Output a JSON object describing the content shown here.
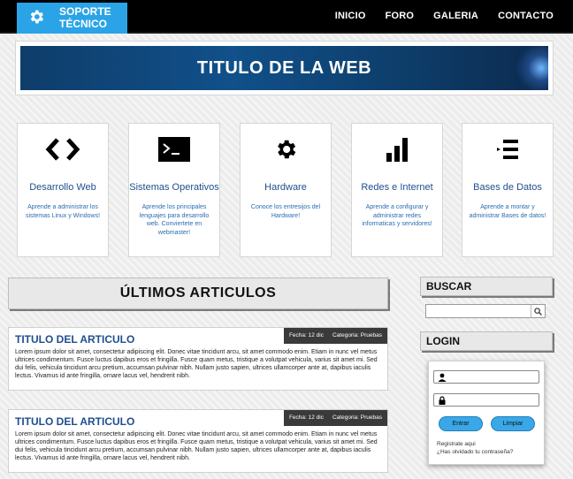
{
  "header": {
    "logo_text": "SOPORTE TÉCNICO",
    "nav": [
      "INICIO",
      "FORO",
      "GALERIA",
      "CONTACTO"
    ]
  },
  "banner": {
    "title": "TITULO DE LA WEB"
  },
  "cards": [
    {
      "icon": "code-icon",
      "title": "Desarrollo Web",
      "desc": "Aprende a administrar los sistemas Linux y Windows!"
    },
    {
      "icon": "terminal-icon",
      "title": "Sistemas Operativos",
      "desc": "Aprende los principales lenguajes para desarrollo web. Conviertete en webmaster!"
    },
    {
      "icon": "gear-icon",
      "title": "Hardware",
      "desc": "Conoce los entresijos del Hardware!"
    },
    {
      "icon": "signal-bars-icon",
      "title": "Redes e Internet",
      "desc": "Aprende a configurar y administrar redes informaticas y servidores!"
    },
    {
      "icon": "list-icon",
      "title": "Bases de Datos",
      "desc": "Aprende a montar y administrar Bases de datos!"
    }
  ],
  "main": {
    "section_title": "ÚLTIMOS ARTICULOS"
  },
  "articles": [
    {
      "title": "TITULO DEL ARTICULO",
      "date": "Fecha: 12 dic",
      "category": "Categoria: Pruebas",
      "body": "Lorem ipsum dolor sit amet, consectetur adipiscing elit. Donec vitae tincidunt arcu, sit amet commodo enim. Etiam in nunc vel metus ultrices condimentum. Fusce luctus dapibus eros et fringilla. Fusce quam metus, tristique a volutpat vehicula, varius sit amet mi. Sed dui felis, vehicula tincidunt arcu pretium, accumsan pulvinar nibh. Nullam justo sapien, ultrices ullamcorper ante at, dapibus iaculis lectus. Vivamus id ante fringilla, ornare lacus vel, hendrerit nibh."
    },
    {
      "title": "TITULO DEL ARTICULO",
      "date": "Fecha: 12 dic",
      "category": "Categoria: Pruebas",
      "body": "Lorem ipsum dolor sit amet, consectetur adipiscing elit. Donec vitae tincidunt arcu, sit amet commodo enim. Etiam in nunc vel metus ultrices condimentum. Fusce luctus dapibus eros et fringilla. Fusce quam metus, tristique a volutpat vehicula, varius sit amet mi. Sed dui felis, vehicula tincidunt arcu pretium, accumsan pulvinar nibh. Nullam justo sapien, ultrices ullamcorper ante at, dapibus iaculis lectus. Vivamus id ante fringilla, ornare lacus vel, hendrerit nibh."
    }
  ],
  "sidebar": {
    "search_title": "BUSCAR",
    "search_value": "",
    "login_title": "LOGIN",
    "login": {
      "user_value": "",
      "pass_value": "",
      "enter_label": "Entrar",
      "clear_label": "Limpiar",
      "register_link": "Registrate aqui",
      "forgot_link": "¿Has olvidado tu contraseña?"
    }
  },
  "colors": {
    "accent": "#2aa4e6",
    "link": "#1f4e8f",
    "topbar": "#000000"
  }
}
